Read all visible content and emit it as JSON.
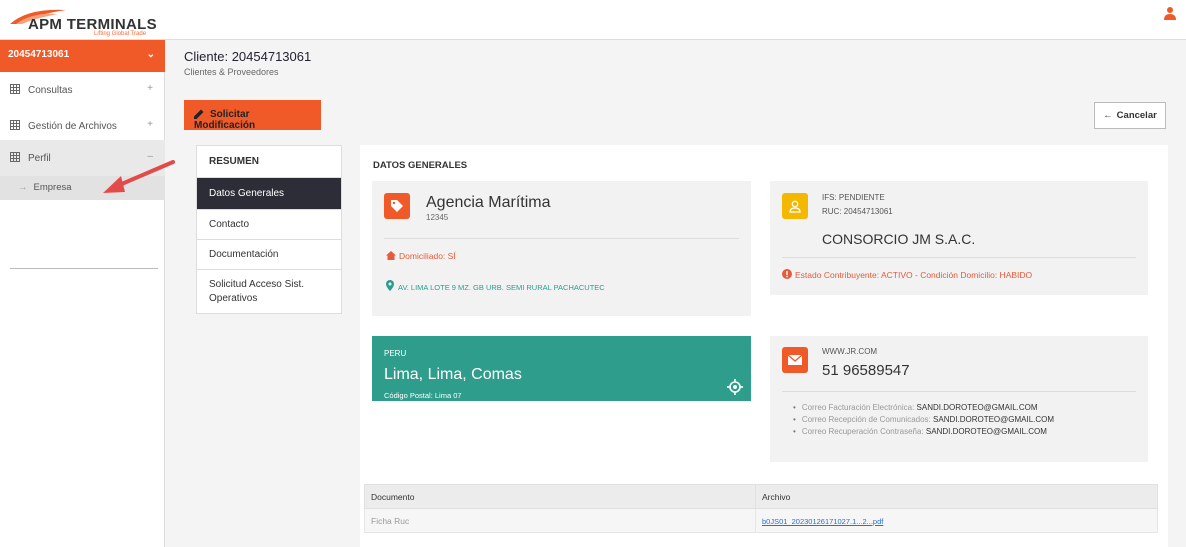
{
  "header": {
    "logo_text": "APM TERMINALS",
    "logo_tagline": "Lifting Global Trade"
  },
  "sidebar": {
    "account": "20454713061",
    "items": [
      {
        "label": "Consultas"
      },
      {
        "label": "Gestión de Archivos"
      },
      {
        "label": "Perfil"
      }
    ],
    "sub_item": "Empresa"
  },
  "page": {
    "title": "Cliente: 20454713061",
    "subtitle": "Clientes & Proveedores",
    "btn_solicitar": "Solicitar Modificación",
    "btn_cancelar": "Cancelar"
  },
  "tabs": {
    "head": "RESUMEN",
    "items": [
      "Datos Generales",
      "Contacto",
      "Documentación",
      "Solicitud Acceso Sist. Operativos"
    ]
  },
  "datos": {
    "section_title": "DATOS GENERALES",
    "agency": {
      "name": "Agencia Marítima",
      "code": "12345",
      "domiciliado": "Domiciliado: SÍ",
      "address": "AV. LIMA LOTE 9 MZ. GB URB. SEMI RURAL PACHACUTEC"
    },
    "company": {
      "ifs": "IFS: PENDIENTE",
      "ruc": "RUC: 20454713061",
      "razon": "CONSORCIO JM S.A.C.",
      "estado": "Estado Contribuyente: ACTIVO - Condición Domicilio: HABIDO"
    },
    "location": {
      "country": "PERU",
      "city": "Lima, Lima, Comas",
      "postal": "Código Postal: Lima 07"
    },
    "contact": {
      "web": "WWW.JR.COM",
      "phone": "51 96589547",
      "mails": [
        {
          "label": "Correo Facturación Electrónica:",
          "value": "SANDI.DOROTEO@GMAIL.COM"
        },
        {
          "label": "Correo Recepción de Comunicados:",
          "value": "SANDI.DOROTEO@GMAIL.COM"
        },
        {
          "label": "Correo Recuperación Contraseña:",
          "value": "SANDI.DOROTEO@GMAIL.COM"
        }
      ]
    }
  },
  "table": {
    "headers": [
      "Documento",
      "Archivo"
    ],
    "rows": [
      {
        "documento": "Ficha Ruc",
        "archivo": "b0JS01_20230126171027.1...2...pdf"
      }
    ]
  },
  "colors": {
    "accent": "#f05a28",
    "teal": "#2e9d8c",
    "yellow": "#f5b800",
    "dark_tab": "#2d2d38"
  },
  "icons": [
    "tag-icon",
    "home-icon",
    "map-pin-icon",
    "user-icon",
    "info-icon",
    "envelope-icon",
    "crosshair-icon",
    "pencil-icon",
    "arrow-left-icon",
    "grid-icon",
    "chevron-down-icon",
    "plus-icon"
  ]
}
